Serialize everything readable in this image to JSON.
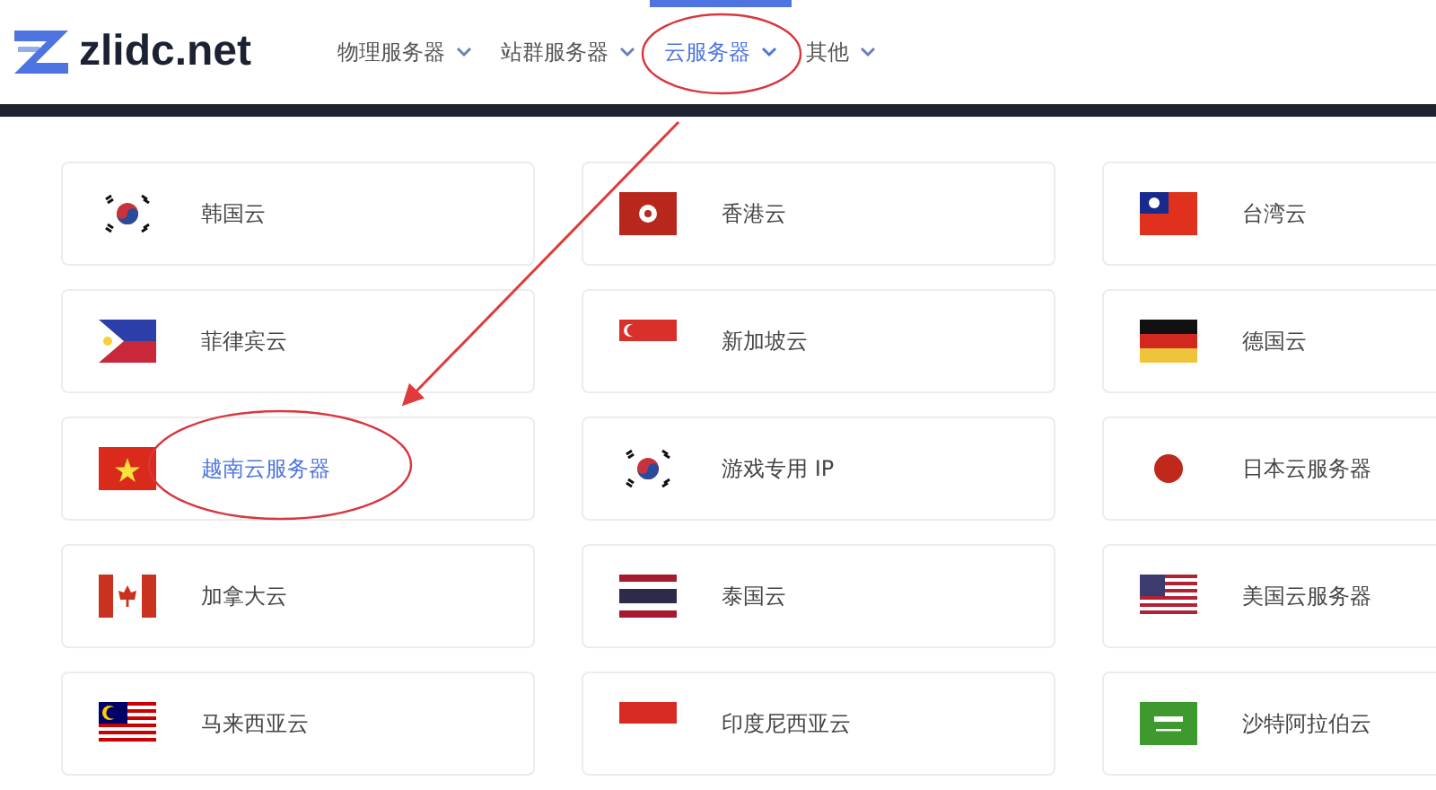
{
  "logo": {
    "text": "zlidc.net"
  },
  "nav": [
    {
      "label": "物理服务器",
      "selected": false
    },
    {
      "label": "站群服务器",
      "selected": false
    },
    {
      "label": "云服务器",
      "selected": true
    },
    {
      "label": "其他",
      "selected": false
    }
  ],
  "cards": [
    {
      "label": "韩国云",
      "kind": "kr",
      "selected": false
    },
    {
      "label": "香港云",
      "kind": "hk",
      "selected": false
    },
    {
      "label": "台湾云",
      "kind": "tw",
      "selected": false
    },
    {
      "label": "菲律宾云",
      "kind": "ph",
      "selected": false
    },
    {
      "label": "新加坡云",
      "kind": "sg",
      "selected": false
    },
    {
      "label": "德国云",
      "kind": "de",
      "selected": false
    },
    {
      "label": "越南云服务器",
      "kind": "vn",
      "selected": true
    },
    {
      "label": "游戏专用 IP",
      "kind": "kr",
      "selected": false
    },
    {
      "label": "日本云服务器",
      "kind": "jp",
      "selected": false
    },
    {
      "label": "加拿大云",
      "kind": "ca",
      "selected": false
    },
    {
      "label": "泰国云",
      "kind": "th",
      "selected": false
    },
    {
      "label": "美国云服务器",
      "kind": "us",
      "selected": false
    },
    {
      "label": "马来西亚云",
      "kind": "my",
      "selected": false
    },
    {
      "label": "印度尼西亚云",
      "kind": "id",
      "selected": false
    },
    {
      "label": "沙特阿拉伯云",
      "kind": "sa",
      "selected": false
    }
  ]
}
